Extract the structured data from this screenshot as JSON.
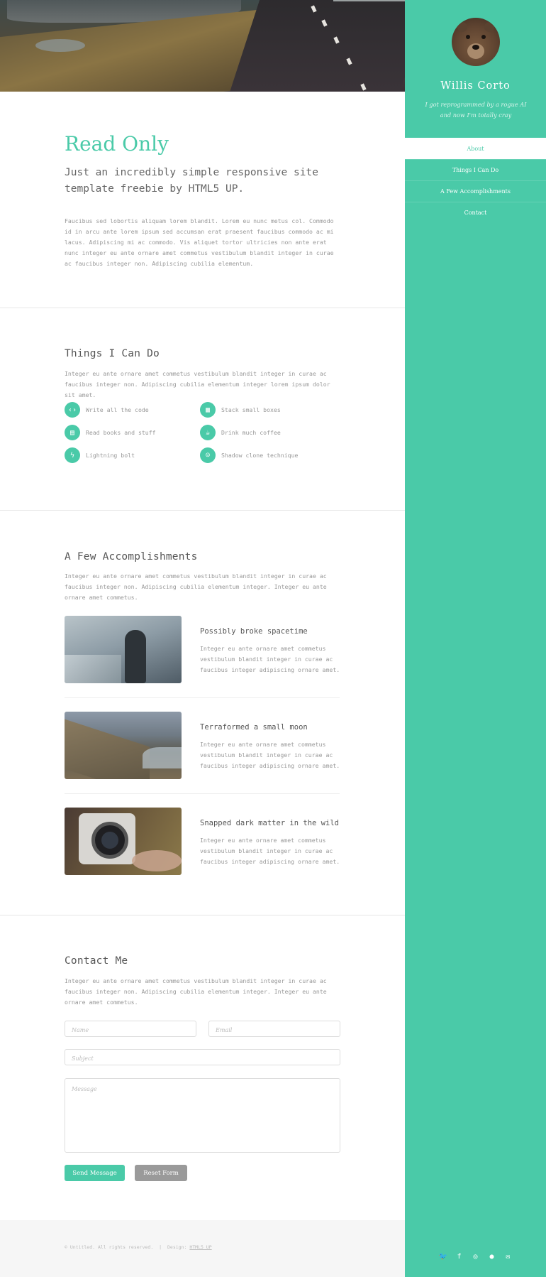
{
  "intro": {
    "title": "Read Only",
    "lead": "Just an incredibly simple responsive site template freebie by HTML5 UP.",
    "body": "Faucibus sed lobortis aliquam lorem blandit. Lorem eu nunc metus col. Commodo id in arcu ante lorem ipsum sed accumsan erat praesent faucibus commodo ac mi lacus. Adipiscing mi ac commodo. Vis aliquet tortor ultricies non ante erat nunc integer eu ante ornare amet commetus vestibulum blandit integer in curae ac faucibus integer non. Adipiscing cubilia elementum."
  },
  "skills": {
    "title": "Things I Can Do",
    "body": "Integer eu ante ornare amet commetus vestibulum blandit integer in curae ac faucibus integer non. Adipiscing cubilia elementum integer lorem ipsum dolor sit amet.",
    "items": [
      {
        "label": "Write all the code",
        "icon": "code-icon"
      },
      {
        "label": "Stack small boxes",
        "icon": "cubes-icon"
      },
      {
        "label": "Read books and stuff",
        "icon": "book-icon"
      },
      {
        "label": "Drink much coffee",
        "icon": "coffee-icon"
      },
      {
        "label": "Lightning bolt",
        "icon": "bolt-icon"
      },
      {
        "label": "Shadow clone technique",
        "icon": "users-icon"
      }
    ]
  },
  "accomplishments": {
    "title": "A Few Accomplishments",
    "body": "Integer eu ante ornare amet commetus vestibulum blandit integer in curae ac faucibus integer non. Adipiscing cubilia elementum integer. Integer eu ante ornare amet commetus.",
    "items": [
      {
        "title": "Possibly broke spacetime",
        "text": "Integer eu ante ornare amet commetus vestibulum blandit integer in curae ac faucibus integer adipiscing ornare amet."
      },
      {
        "title": "Terraformed a small moon",
        "text": "Integer eu ante ornare amet commetus vestibulum blandit integer in curae ac faucibus integer adipiscing ornare amet."
      },
      {
        "title": "Snapped dark matter in the wild",
        "text": "Integer eu ante ornare amet commetus vestibulum blandit integer in curae ac faucibus integer adipiscing ornare amet."
      }
    ]
  },
  "contact": {
    "title": "Contact Me",
    "body": "Integer eu ante ornare amet commetus vestibulum blandit integer in curae ac faucibus integer non. Adipiscing cubilia elementum integer. Integer eu ante ornare amet commetus.",
    "name_placeholder": "Name",
    "email_placeholder": "Email",
    "subject_placeholder": "Subject",
    "message_placeholder": "Message",
    "send_label": "Send Message",
    "reset_label": "Reset Form"
  },
  "footer": {
    "copyright": "© Untitled. All rights reserved.",
    "separator": "|",
    "design_prefix": "Design:",
    "design_link": "HTML5 UP"
  },
  "sidebar": {
    "name": "Willis Corto",
    "tagline": "I got reprogrammed by a rogue AI and now I'm totally cray",
    "nav": [
      "About",
      "Things I Can Do",
      "A Few Accomplishments",
      "Contact"
    ],
    "social": [
      {
        "icon": "twitter-icon",
        "glyph": "🐦"
      },
      {
        "icon": "facebook-icon",
        "glyph": "f"
      },
      {
        "icon": "instagram-icon",
        "glyph": "◎"
      },
      {
        "icon": "github-icon",
        "glyph": "●"
      },
      {
        "icon": "email-icon",
        "glyph": "✉"
      }
    ]
  },
  "colors": {
    "accent": "#4acaa8",
    "reset_button": "#9a9a9a"
  }
}
